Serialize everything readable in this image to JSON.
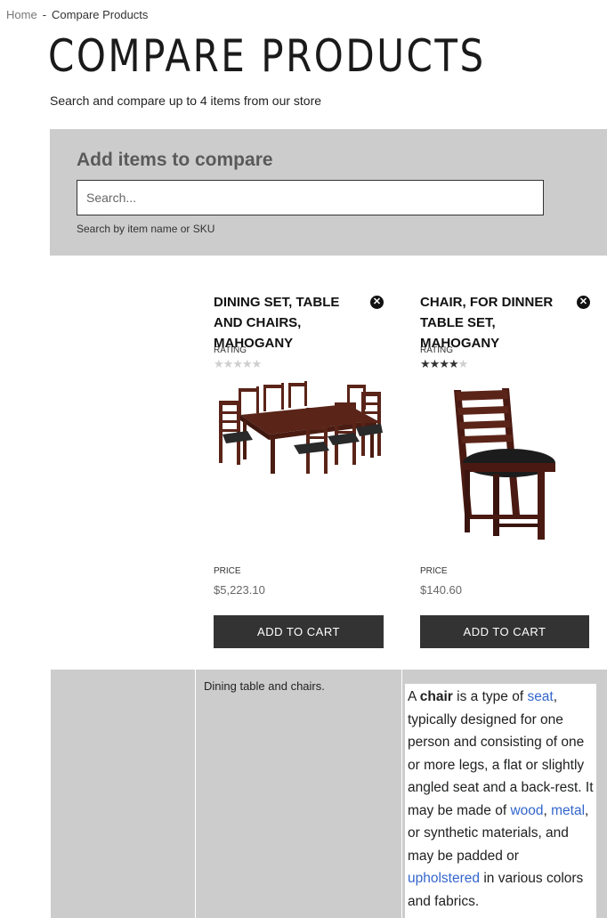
{
  "breadcrumb": {
    "home": "Home",
    "separator": "-",
    "current": "Compare Products"
  },
  "page": {
    "title": "COMPARE PRODUCTS",
    "subtitle": "Search and compare up to 4 items from our store"
  },
  "add_panel": {
    "heading": "Add items to compare",
    "search_placeholder": "Search...",
    "hint": "Search by item name or SKU"
  },
  "products": [
    {
      "name": "DINING SET, TABLE AND CHAIRS, MAHOGANY",
      "rating_label": "RATING",
      "rating": 0,
      "rating_max": 5,
      "price_label": "PRICE",
      "price": "$5,223.10",
      "cart_label": "ADD TO CART",
      "remove_icon": "close-circle-icon",
      "description": "Dining table and chairs."
    },
    {
      "name": "CHAIR, FOR DINNER TABLE SET, MAHOGANY",
      "rating_label": "RATING",
      "rating": 4,
      "rating_max": 5,
      "price_label": "PRICE",
      "price": "$140.60",
      "cart_label": "ADD TO CART",
      "remove_icon": "close-circle-icon",
      "description": {
        "t1": "A ",
        "bold": "chair",
        "t2": " is a type of ",
        "link_seat": "seat",
        "t3": ", typically designed for one person and consisting of one or more legs, a flat or slightly angled seat and a back-rest. It may be made of ",
        "link_wood": "wood",
        "t4": ", ",
        "link_metal": "metal",
        "t5": ", or synthetic materials, and may be padded or ",
        "link_upholstered": "upholstered",
        "t6": " in various colors and fabrics."
      }
    }
  ],
  "colors": {
    "panel_bg": "#cccccc",
    "button_bg": "#333333",
    "link": "#3366cc"
  }
}
